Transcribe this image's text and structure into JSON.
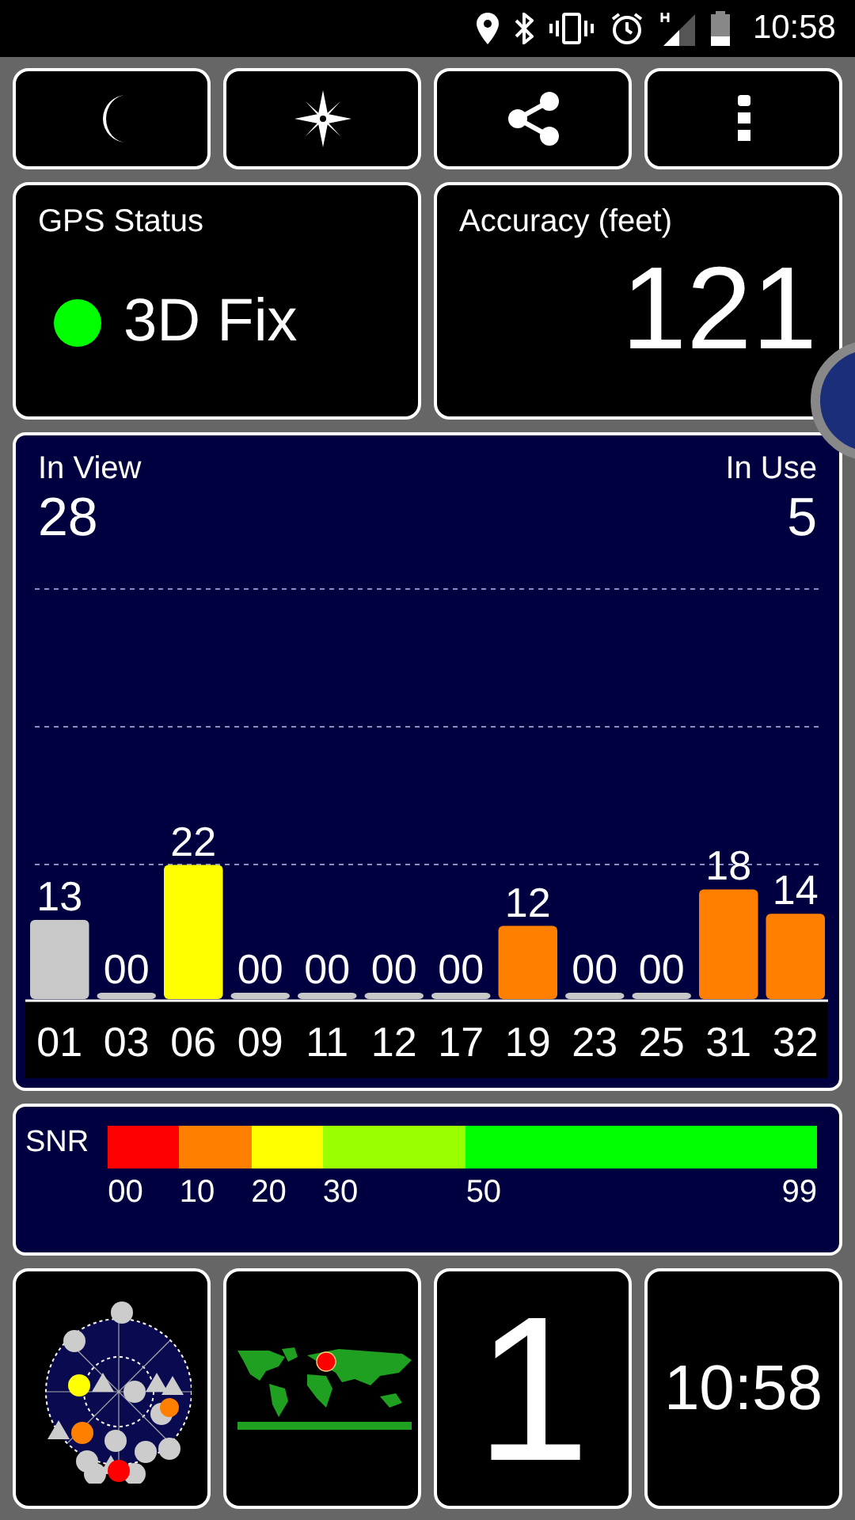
{
  "status_bar": {
    "time": "10:58"
  },
  "gps_status": {
    "label": "GPS Status",
    "value": "3D Fix"
  },
  "accuracy": {
    "label": "Accuracy (feet)",
    "value": "121"
  },
  "signal_panel": {
    "in_view_label": "In View",
    "in_view": "28",
    "in_use_label": "In Use",
    "in_use": "5",
    "bars_in_use": [
      false,
      false,
      true,
      false,
      false,
      false,
      false,
      true,
      false,
      false,
      true,
      true
    ],
    "chart_data": {
      "type": "bar",
      "categories": [
        "01",
        "03",
        "06",
        "09",
        "11",
        "12",
        "17",
        "19",
        "23",
        "25",
        "31",
        "32"
      ],
      "values": [
        13,
        0,
        22,
        0,
        0,
        0,
        0,
        12,
        0,
        0,
        18,
        14
      ],
      "value_labels": [
        "13",
        "00",
        "22",
        "00",
        "00",
        "00",
        "00",
        "12",
        "00",
        "00",
        "18",
        "14"
      ]
    }
  },
  "snr_legend": {
    "label": "SNR",
    "ticks": [
      "00",
      "10",
      "20",
      "30",
      "50",
      "99"
    ],
    "segments": [
      {
        "color": "#ff0000"
      },
      {
        "color": "#ff8000"
      },
      {
        "color": "#ffff00"
      },
      {
        "color": "#99ff00"
      },
      {
        "color": "#00ff00"
      }
    ]
  },
  "tiles": {
    "satellite_count": "1",
    "clock": "10:58"
  }
}
